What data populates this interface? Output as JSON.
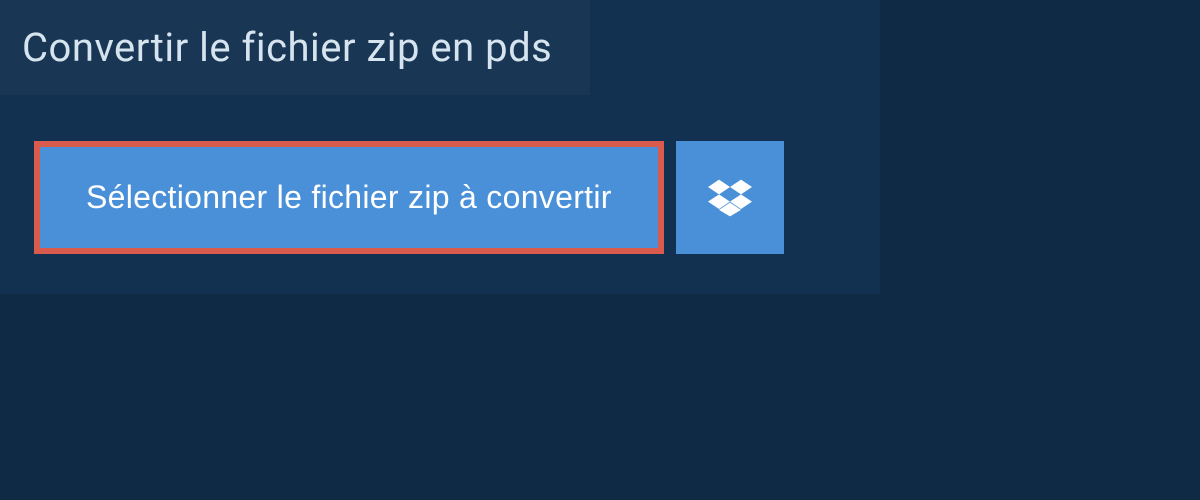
{
  "panel": {
    "title": "Convertir le fichier zip en pds",
    "select_button_label": "Sélectionner le fichier zip à convertir"
  },
  "colors": {
    "page_bg": "#0f2a44",
    "panel_bg": "#12304f",
    "title_bg": "#193754",
    "button_bg": "#4a90d9",
    "highlight_border": "#d95b4e",
    "text_light": "#d6e4ef",
    "text_white": "#ffffff"
  }
}
